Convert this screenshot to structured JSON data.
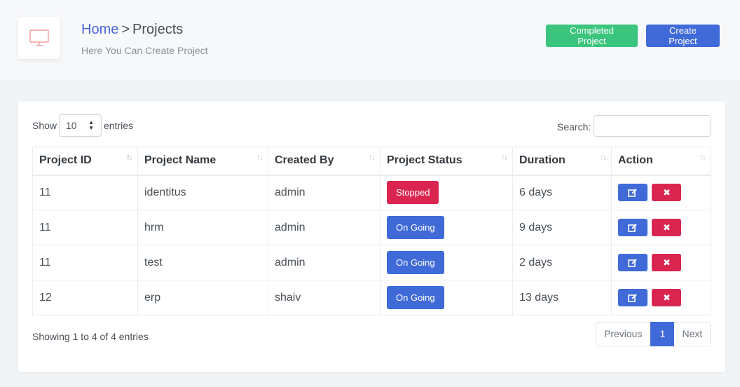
{
  "header": {
    "breadcrumb_home": "Home",
    "breadcrumb_sep": ">",
    "breadcrumb_current": "Projects",
    "subtitle": "Here You Can Create Project",
    "icon": "monitor-icon",
    "completed_button": "Completed Project",
    "create_button": "Create Project"
  },
  "controls": {
    "show_label": "Show",
    "entries_value": "10",
    "entries_label": "entries",
    "search_label": "Search:",
    "search_value": ""
  },
  "table": {
    "columns": [
      "Project ID",
      "Project Name",
      "Created By",
      "Project Status",
      "Duration",
      "Action"
    ],
    "rows": [
      {
        "id": "11",
        "name": "identitus",
        "created_by": "admin",
        "status": "Stopped",
        "duration": "6 days"
      },
      {
        "id": "11",
        "name": "hrm",
        "created_by": "admin",
        "status": "On Going",
        "duration": "9 days"
      },
      {
        "id": "11",
        "name": "test",
        "created_by": "admin",
        "status": "On Going",
        "duration": "2 days"
      },
      {
        "id": "12",
        "name": "erp",
        "created_by": "shaiv",
        "status": "On Going",
        "duration": "13 days"
      }
    ]
  },
  "footer": {
    "info": "Showing 1 to 4 of 4 entries",
    "previous": "Previous",
    "current_page": "1",
    "next": "Next"
  },
  "colors": {
    "primary": "#3f6ad8",
    "success": "#3ac47d",
    "danger": "#d92550"
  }
}
